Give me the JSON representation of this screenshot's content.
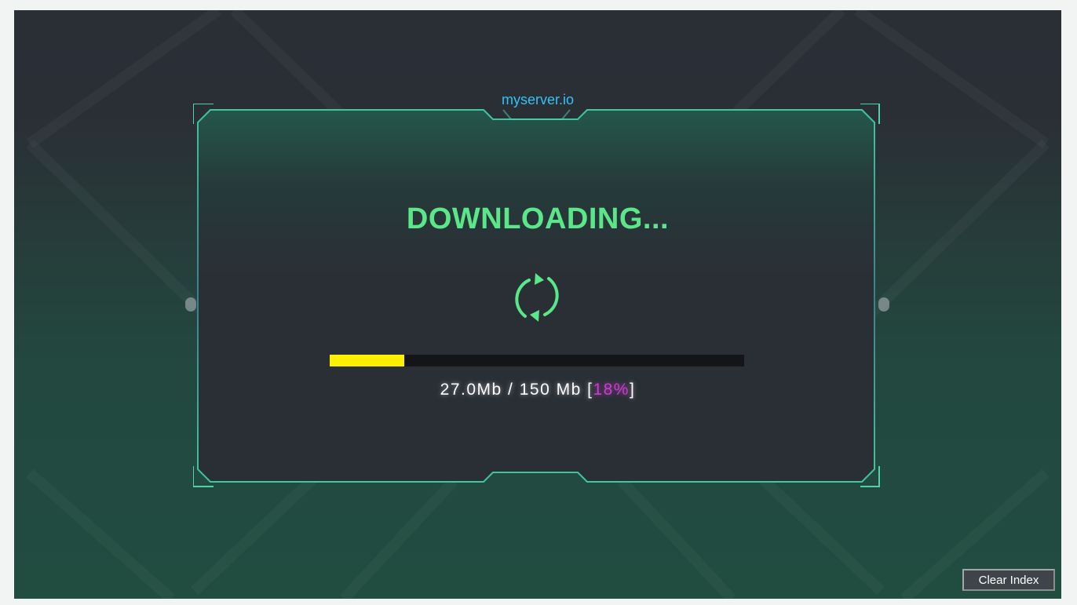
{
  "server": {
    "host": "myserver.io"
  },
  "status": {
    "title": "DOWNLOADING..."
  },
  "spinner": {
    "icon": "refresh-icon",
    "color": "#5be789"
  },
  "progress": {
    "percent_value": 18,
    "downloaded": "27.0Mb",
    "separator": " / ",
    "total": "150 Mb",
    "bracket_open": " [",
    "percent_label": "18%",
    "bracket_close": "]"
  },
  "colors": {
    "title": "#5be789",
    "host": "#32c3f5",
    "progress_fill": "#fff000",
    "progress_track": "#141518",
    "percent": "#cc3bcf",
    "frame": "#4fd3a6"
  },
  "controls": {
    "clear_index_label": "Clear Index"
  }
}
